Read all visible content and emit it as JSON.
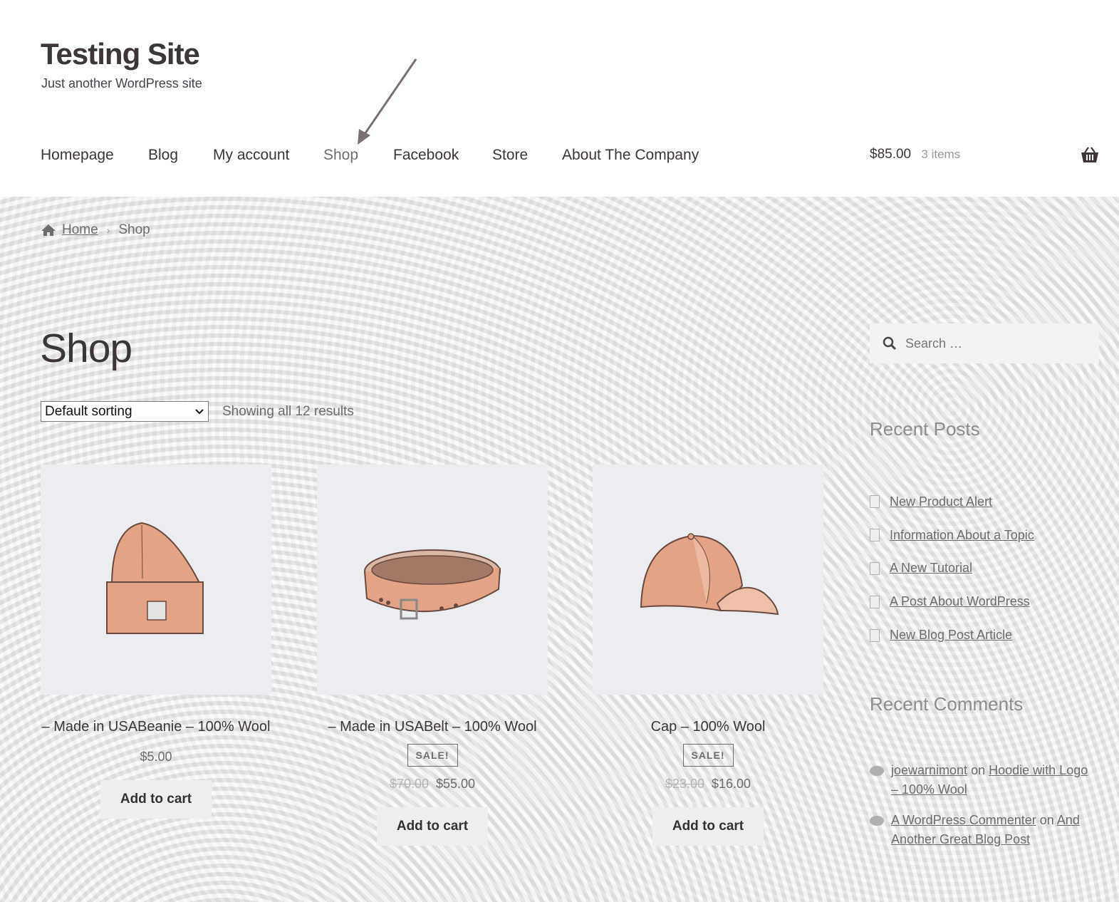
{
  "site": {
    "title": "Testing Site",
    "description": "Just another WordPress site"
  },
  "nav": {
    "items": [
      "Homepage",
      "Blog",
      "My account",
      "Shop",
      "Facebook",
      "Store",
      "About The Company"
    ],
    "active": "Shop"
  },
  "cart": {
    "amount": "$85.00",
    "count": "3 items",
    "icon": "basket-icon"
  },
  "breadcrumb": {
    "home": "Home",
    "current": "Shop"
  },
  "page": {
    "title": "Shop"
  },
  "toolbar": {
    "sorting": "Default sorting",
    "result_count": "Showing all 12 results"
  },
  "products": [
    {
      "title": "– Made in USABeanie – 100% Wool",
      "sale": "",
      "old_price": "",
      "price": "$5.00",
      "button": "Add to cart"
    },
    {
      "title": "– Made in USABelt – 100% Wool",
      "sale": "SALE!",
      "old_price": "$70.00",
      "price": "$55.00",
      "button": "Add to cart"
    },
    {
      "title": "Cap – 100% Wool",
      "sale": "SALE!",
      "old_price": "$23.00",
      "price": "$16.00",
      "button": "Add to cart"
    }
  ],
  "sidebar": {
    "search_placeholder": "Search …",
    "recent_posts_title": "Recent Posts",
    "recent_posts": [
      "New Product Alert",
      "Information About a Topic",
      "A New Tutorial",
      "A Post About WordPress",
      "New Blog Post Article"
    ],
    "recent_comments_title": "Recent Comments",
    "comments": [
      {
        "author": "joewarnimont",
        "on": "on",
        "post": "Hoodie with Logo – 100% Wool"
      },
      {
        "author": "A WordPress Commenter",
        "on": "on",
        "post": "And Another Great Blog Post"
      }
    ]
  },
  "colors": {
    "text": "#43454b",
    "muted": "#6d6d6d",
    "product_accent": "#e5a385"
  }
}
